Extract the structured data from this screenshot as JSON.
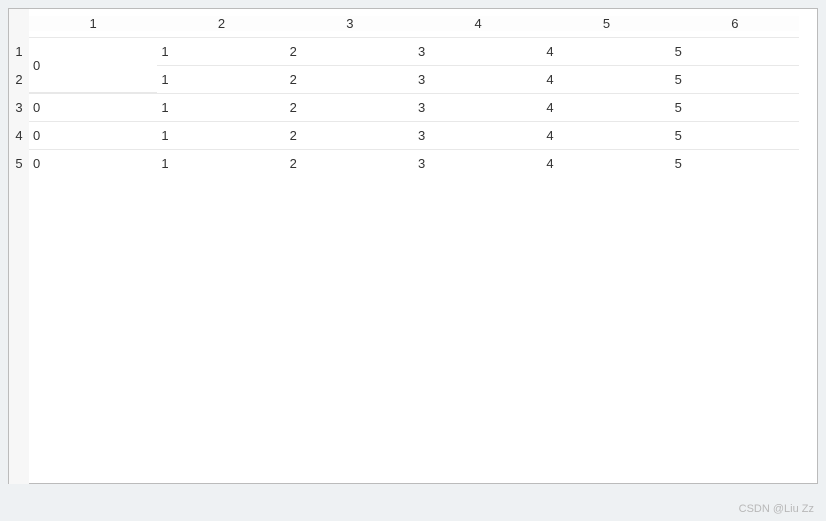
{
  "columns": [
    "1",
    "2",
    "3",
    "4",
    "5",
    "6"
  ],
  "row_numbers": [
    "1",
    "2",
    "3",
    "4",
    "5"
  ],
  "merged_cell": {
    "value": "0",
    "rows": [
      0,
      1
    ],
    "col": 0
  },
  "cells": [
    [
      "",
      "1",
      "2",
      "3",
      "4",
      "5"
    ],
    [
      "",
      "1",
      "2",
      "3",
      "4",
      "5"
    ],
    [
      "0",
      "1",
      "2",
      "3",
      "4",
      "5"
    ],
    [
      "0",
      "1",
      "2",
      "3",
      "4",
      "5"
    ],
    [
      "0",
      "1",
      "2",
      "3",
      "4",
      "5"
    ]
  ],
  "chart_data": {
    "type": "table",
    "columns": [
      "1",
      "2",
      "3",
      "4",
      "5",
      "6"
    ],
    "rows": [
      {
        "row": "1",
        "values": [
          "0",
          "1",
          "2",
          "3",
          "4",
          "5"
        ]
      },
      {
        "row": "2",
        "values": [
          "0",
          "1",
          "2",
          "3",
          "4",
          "5"
        ]
      },
      {
        "row": "3",
        "values": [
          "0",
          "1",
          "2",
          "3",
          "4",
          "5"
        ]
      },
      {
        "row": "4",
        "values": [
          "0",
          "1",
          "2",
          "3",
          "4",
          "5"
        ]
      },
      {
        "row": "5",
        "values": [
          "0",
          "1",
          "2",
          "3",
          "4",
          "5"
        ]
      }
    ],
    "note": "Column 1 rows 1-2 share a merged cell with value 0"
  },
  "watermark": "CSDN @Liu Zz"
}
